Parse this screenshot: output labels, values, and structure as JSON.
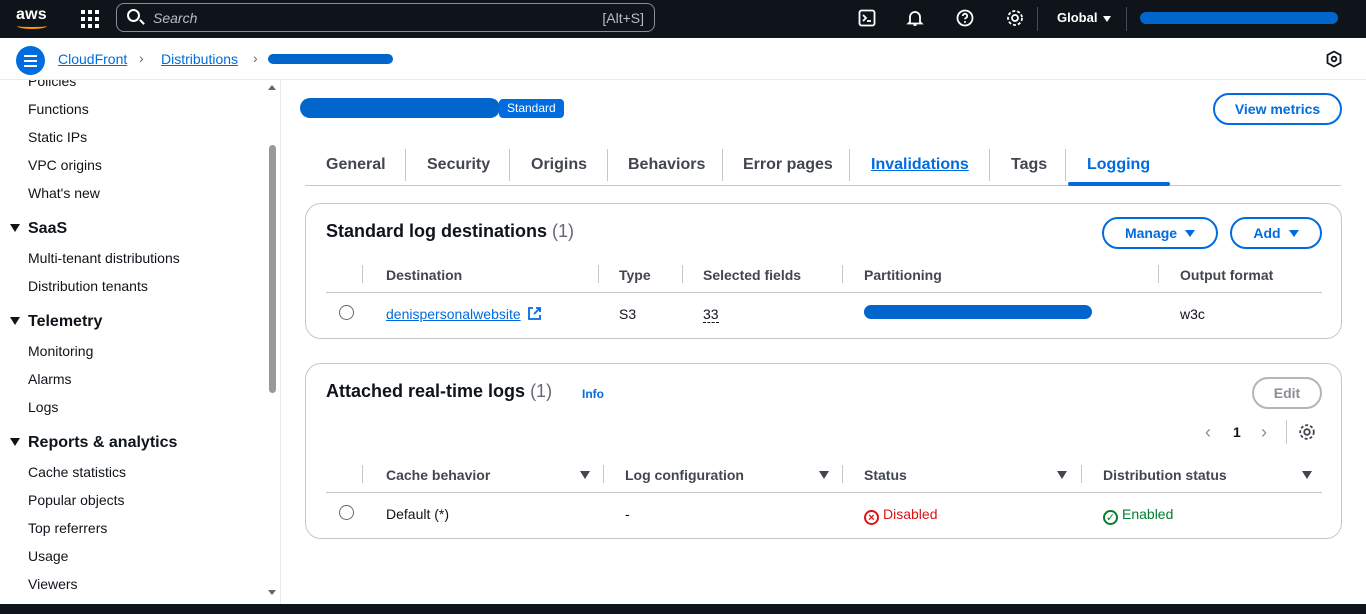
{
  "topbar": {
    "logo": "aws",
    "search_placeholder": "Search",
    "search_shortcut": "[Alt+S]",
    "region": "Global",
    "icons": [
      "grid-icon",
      "search-icon",
      "cloudshell-icon",
      "bell-icon",
      "help-icon",
      "gear-icon"
    ]
  },
  "breadcrumb": {
    "items": [
      "CloudFront",
      "Distributions"
    ]
  },
  "sidebar": {
    "top_items": [
      "Policies",
      "Functions",
      "Static IPs",
      "VPC origins",
      "What's new"
    ],
    "sections": [
      {
        "title": "SaaS",
        "items": [
          "Multi-tenant distributions",
          "Distribution tenants"
        ]
      },
      {
        "title": "Telemetry",
        "items": [
          "Monitoring",
          "Alarms",
          "Logs"
        ]
      },
      {
        "title": "Reports & analytics",
        "items": [
          "Cache statistics",
          "Popular objects",
          "Top referrers",
          "Usage",
          "Viewers"
        ]
      }
    ]
  },
  "header": {
    "badge": "Standard",
    "view_metrics": "View metrics"
  },
  "tabs": [
    "General",
    "Security",
    "Origins",
    "Behaviors",
    "Error pages",
    "Invalidations",
    "Tags",
    "Logging"
  ],
  "active_tab": "Logging",
  "standard_logs": {
    "title": "Standard log destinations",
    "count": "(1)",
    "manage_label": "Manage",
    "add_label": "Add",
    "columns": [
      "Destination",
      "Type",
      "Selected fields",
      "Partitioning",
      "Output format"
    ],
    "rows": [
      {
        "destination": "denispersonalwebsite",
        "type": "S3",
        "selected_fields": "33",
        "output_format": "w3c"
      }
    ]
  },
  "realtime_logs": {
    "title": "Attached real-time logs",
    "count": "(1)",
    "info": "Info",
    "edit_label": "Edit",
    "page": "1",
    "columns": [
      "Cache behavior",
      "Log configuration",
      "Status",
      "Distribution status"
    ],
    "rows": [
      {
        "cache_behavior": "Default (*)",
        "log_configuration": "-",
        "status": "Disabled",
        "distribution_status": "Enabled"
      }
    ]
  },
  "colors": {
    "accent": "#006ce0",
    "topbar": "#0f141a",
    "error": "#d91515",
    "success": "#00802f"
  }
}
